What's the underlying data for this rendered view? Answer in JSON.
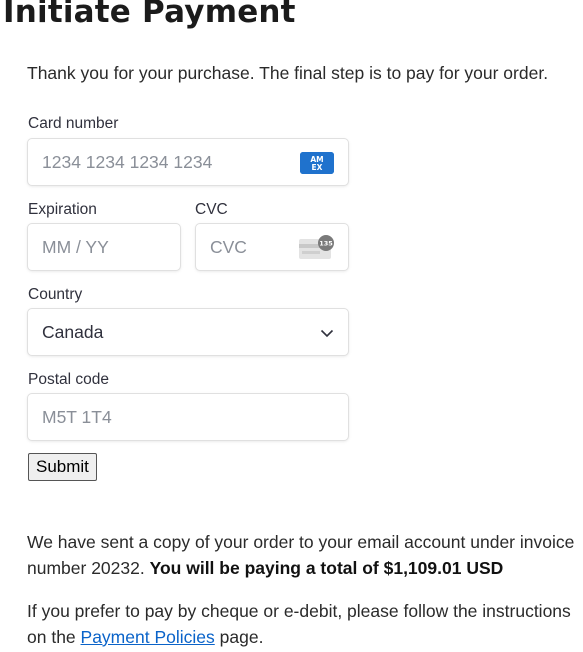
{
  "page": {
    "title": "Initiate Payment",
    "intro": "Thank you for your purchase. The final step is to pay for your order."
  },
  "form": {
    "card_number": {
      "label": "Card number",
      "placeholder": "1234 1234 1234 1234",
      "brand_icon": "amex-card-icon"
    },
    "expiration": {
      "label": "Expiration",
      "placeholder": "MM / YY"
    },
    "cvc": {
      "label": "CVC",
      "placeholder": "CVC",
      "badge_number": "135",
      "icon": "cvc-card-icon"
    },
    "country": {
      "label": "Country",
      "value": "Canada"
    },
    "postal_code": {
      "label": "Postal code",
      "placeholder": "M5T 1T4"
    },
    "submit_label": "Submit"
  },
  "notice": {
    "line1": "We have sent a copy of your order to your email account under invoice",
    "line2_prefix": "number 20232.",
    "line2_bold": "You will be paying a total of $1,109.01 USD",
    "policy_prefix": "If you prefer to pay by cheque or e-debit, please follow the instructions",
    "policy_line2_prefix": "on the",
    "policy_link": "Payment Policies",
    "policy_suffix": "page."
  },
  "colors": {
    "amex_blue": "#1f72cd",
    "link": "#0a63c9"
  }
}
